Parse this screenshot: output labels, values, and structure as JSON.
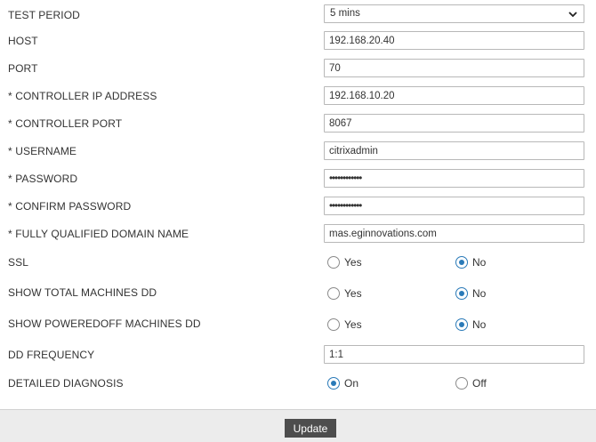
{
  "form": {
    "test_period": {
      "label": "TEST PERIOD",
      "value": "5 mins"
    },
    "host": {
      "label": "HOST",
      "value": "192.168.20.40"
    },
    "port": {
      "label": "PORT",
      "value": "70"
    },
    "controller_ip": {
      "label": "* CONTROLLER IP ADDRESS",
      "value": "192.168.10.20"
    },
    "controller_port": {
      "label": "* CONTROLLER PORT",
      "value": "8067"
    },
    "username": {
      "label": "* USERNAME",
      "value": "citrixadmin"
    },
    "password": {
      "label": "* PASSWORD",
      "value": "••••••••••••"
    },
    "confirm_password": {
      "label": "* CONFIRM PASSWORD",
      "value": "••••••••••••"
    },
    "fqdn": {
      "label": "* FULLY QUALIFIED DOMAIN NAME",
      "value": "mas.eginnovations.com"
    },
    "ssl": {
      "label": "SSL",
      "yes": "Yes",
      "no": "No",
      "selected": "No"
    },
    "show_total_machines_dd": {
      "label": "SHOW TOTAL MACHINES DD",
      "yes": "Yes",
      "no": "No",
      "selected": "No"
    },
    "show_poweredoff_machines_dd": {
      "label": "SHOW POWEREDOFF MACHINES DD",
      "yes": "Yes",
      "no": "No",
      "selected": "No"
    },
    "dd_frequency": {
      "label": "DD FREQUENCY",
      "value": "1:1"
    },
    "detailed_diagnosis": {
      "label": "DETAILED DIAGNOSIS",
      "on": "On",
      "off": "Off",
      "selected": "On"
    }
  },
  "footer": {
    "update_label": "Update"
  },
  "colors": {
    "accent": "#2a7ab8",
    "button": "#4d4d4d",
    "footer_bg": "#ececec"
  },
  "icons": {
    "select_arrow": "chevron-down-icon"
  }
}
